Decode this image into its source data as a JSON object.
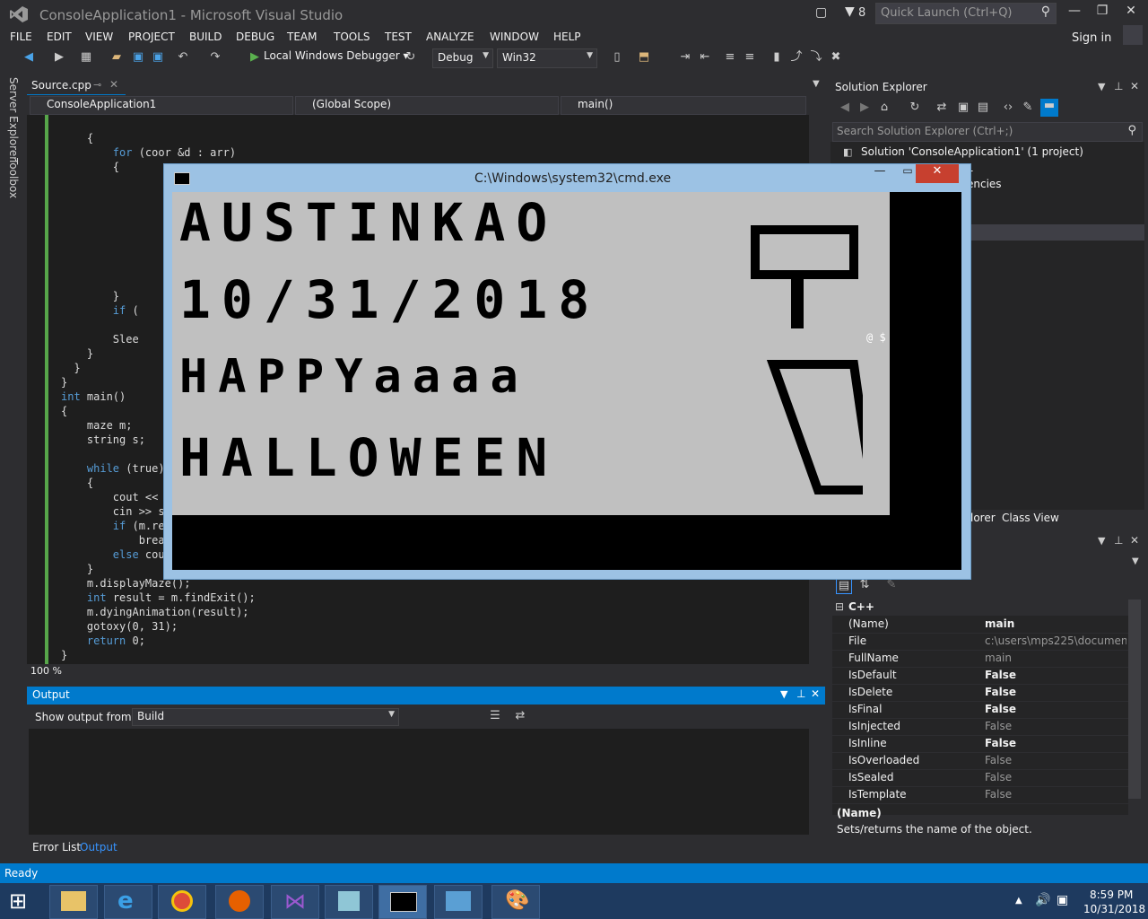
{
  "window": {
    "title": "ConsoleApplication1 - Microsoft Visual Studio",
    "filter_count": "8",
    "quick_launch_placeholder": "Quick Launch (Ctrl+Q)",
    "sign_in": "Sign in"
  },
  "menu": [
    "FILE",
    "EDIT",
    "VIEW",
    "PROJECT",
    "BUILD",
    "DEBUG",
    "TEAM",
    "TOOLS",
    "TEST",
    "ANALYZE",
    "WINDOW",
    "HELP"
  ],
  "toolbar": {
    "debugger_label": "Local Windows Debugger",
    "configuration": "Debug",
    "platform": "Win32"
  },
  "left_tabs": [
    "Server Explorer",
    "Toolbox"
  ],
  "editor": {
    "file_tab": "Source.cpp",
    "nav_project": "ConsoleApplication1",
    "nav_scope": "(Global Scope)",
    "nav_member": "main()",
    "zoom": "100 %",
    "lines": [
      "    {",
      "        for (coor &d : arr)",
      "        {",
      "",
      "",
      "",
      "",
      "",
      "",
      "",
      "",
      "        }",
      "        if (",
      "",
      "        Slee",
      "    }",
      "  }",
      "}",
      "int main()",
      "{",
      "    maze m;",
      "    string s;",
      "",
      "    while (true)",
      "    {",
      "        cout <<",
      "        cin >> s",
      "        if (m.re",
      "            brea",
      "        else cou",
      "    }",
      "    m.displayMaze();",
      "    int result = m.findExit();",
      "    m.dyingAnimation(result);",
      "    gotoxy(0, 31);",
      "    return 0;",
      "}"
    ]
  },
  "output": {
    "title": "Output",
    "show_from_label": "Show output from:",
    "source": "Build"
  },
  "bottom_tabs": [
    "Error List",
    "Output"
  ],
  "solution_explorer": {
    "title": "Solution Explorer",
    "search_placeholder": "Search Solution Explorer (Ctrl+;)",
    "root": "Solution 'ConsoleApplication1' (1 project)",
    "partial_1": "1",
    "partial_2": "encies",
    "tab_explorer_partial": "lorer",
    "tab_class_view": "Class View"
  },
  "properties": {
    "category": "C++",
    "rows": [
      {
        "name": "(Name)",
        "value": "main",
        "bold": true
      },
      {
        "name": "File",
        "value": "c:\\users\\mps225\\documents",
        "bold": false
      },
      {
        "name": "FullName",
        "value": "main",
        "bold": false
      },
      {
        "name": "IsDefault",
        "value": "False",
        "bold": true
      },
      {
        "name": "IsDelete",
        "value": "False",
        "bold": true
      },
      {
        "name": "IsFinal",
        "value": "False",
        "bold": true
      },
      {
        "name": "IsInjected",
        "value": "False",
        "bold": false
      },
      {
        "name": "IsInline",
        "value": "False",
        "bold": true
      },
      {
        "name": "IsOverloaded",
        "value": "False",
        "bold": false
      },
      {
        "name": "IsSealed",
        "value": "False",
        "bold": false
      },
      {
        "name": "IsTemplate",
        "value": "False",
        "bold": false
      }
    ],
    "desc_title": "(Name)",
    "desc_text": "Sets/returns the name of the object."
  },
  "status": "Ready",
  "cmd": {
    "title": "C:\\Windows\\system32\\cmd.exe",
    "art_lines": [
      "AUSTINKAO",
      "10/31/2018",
      "HAPPYaaaa",
      "HALLOWEEN"
    ],
    "stray": "@ $"
  },
  "taskbar": {
    "time": "8:59 PM",
    "date": "10/31/2018"
  },
  "colors": {
    "accent": "#007acc",
    "background": "#2d2d30",
    "editor_bg": "#1e1e1e",
    "keyword": "#569cd6",
    "cmd_art_bg": "#c0c0c0"
  }
}
